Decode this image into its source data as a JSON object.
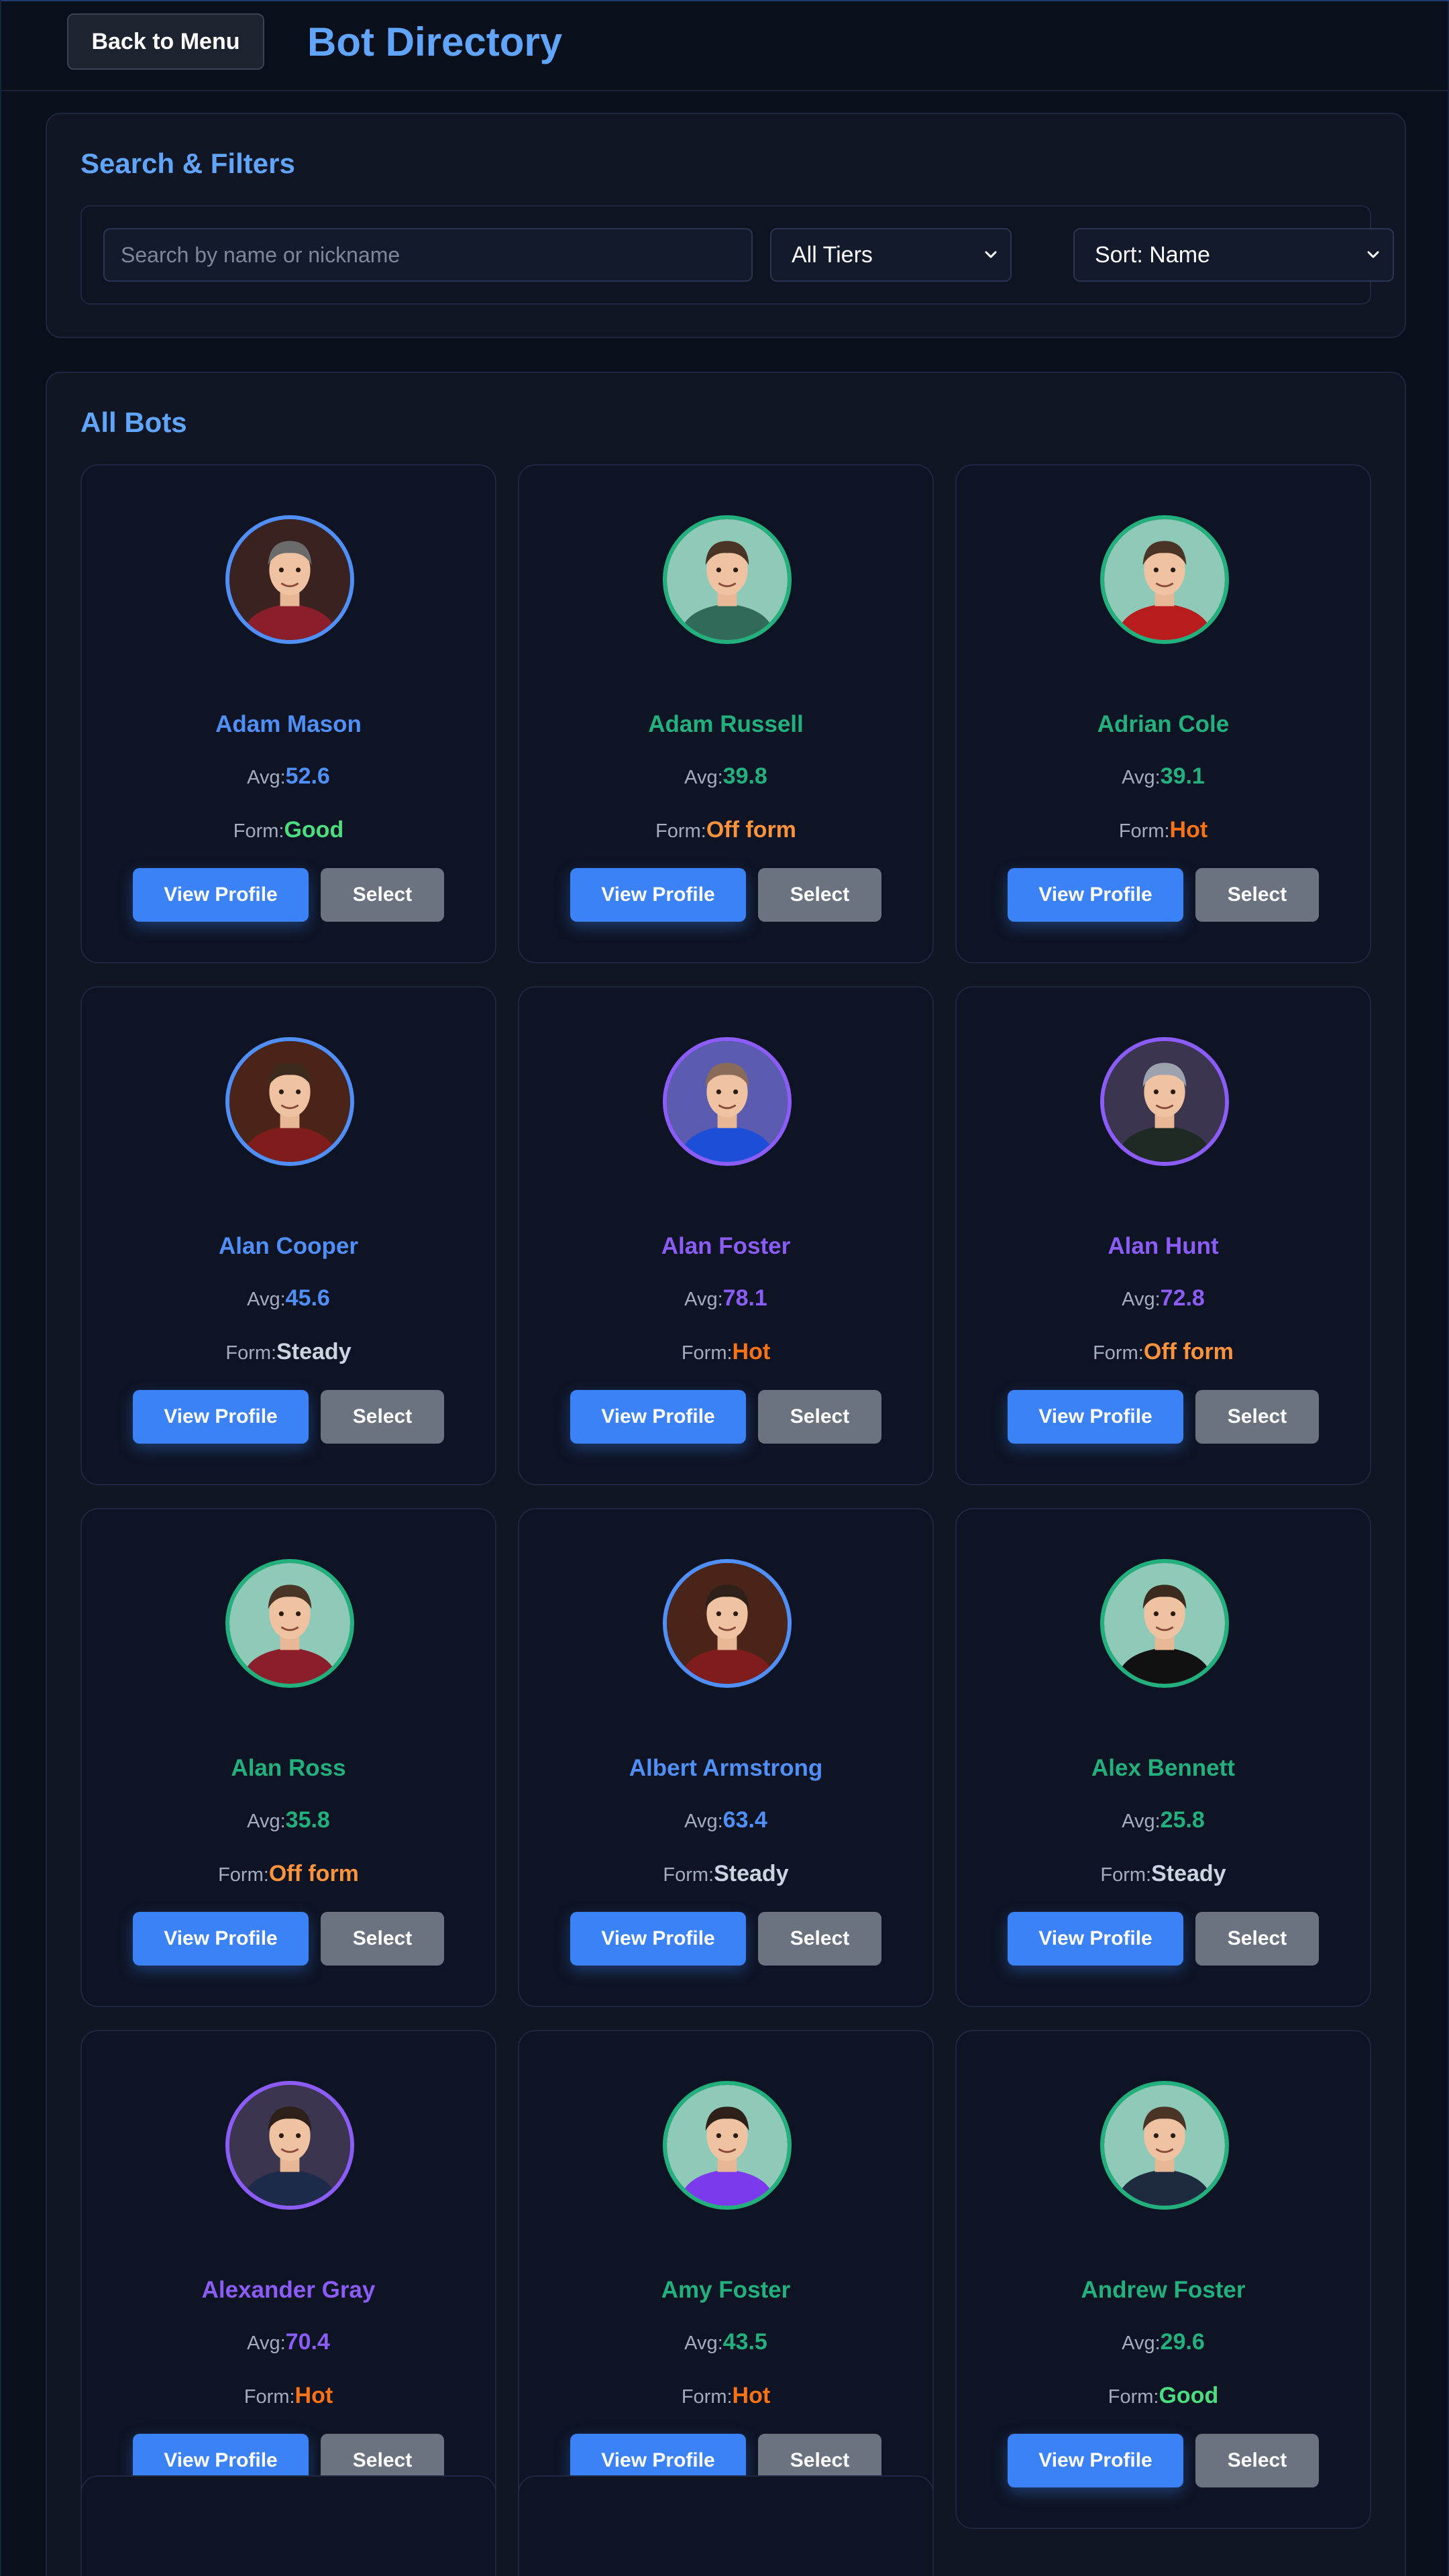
{
  "header": {
    "back_label": "Back to Menu",
    "title": "Bot Directory"
  },
  "filters": {
    "title": "Search & Filters",
    "search_placeholder": "Search by name or nickname",
    "tier_value": "All Tiers",
    "sort_value": "Sort: Name"
  },
  "bots_section": {
    "title": "All Bots",
    "avg_label": "Avg:",
    "form_label": "Form:",
    "view_label": "View Profile",
    "select_label": "Select"
  },
  "colors": {
    "tier_blue": "#4f8ff7",
    "tier_green": "#22b07d",
    "tier_purple": "#8b5cf6",
    "form_good": "#4ade80",
    "form_hot": "#f97316",
    "form_off": "#fb923c",
    "form_steady": "#cbd5e1"
  },
  "bots": [
    {
      "name": "Adam Mason",
      "avg": "52.6",
      "form": "Good",
      "tier": "blue",
      "shirt": "#8b1e2b",
      "bg": "#3a2220",
      "hair": "#6b6b6b"
    },
    {
      "name": "Adam Russell",
      "avg": "39.8",
      "form": "Off form",
      "tier": "green",
      "shirt": "#2f6b58",
      "bg": "#8fc9b8",
      "hair": "#4a3426"
    },
    {
      "name": "Adrian Cole",
      "avg": "39.1",
      "form": "Hot",
      "tier": "green",
      "shirt": "#b91c1c",
      "bg": "#8fc9b8",
      "hair": "#4a3426"
    },
    {
      "name": "Alan Cooper",
      "avg": "45.6",
      "form": "Steady",
      "tier": "blue",
      "shirt": "#7f1d1d",
      "bg": "#4a2418",
      "hair": "#3d2a1e"
    },
    {
      "name": "Alan Foster",
      "avg": "78.1",
      "form": "Hot",
      "tier": "purple",
      "shirt": "#1d4ed8",
      "bg": "#5b5bb0",
      "hair": "#8a6b5a"
    },
    {
      "name": "Alan Hunt",
      "avg": "72.8",
      "form": "Off form",
      "tier": "purple",
      "shirt": "#1f2a24",
      "bg": "#3b3550",
      "hair": "#9ca3af"
    },
    {
      "name": "Alan Ross",
      "avg": "35.8",
      "form": "Off form",
      "tier": "green",
      "shirt": "#8b1e2b",
      "bg": "#8fc9b8",
      "hair": "#4a3426"
    },
    {
      "name": "Albert Armstrong",
      "avg": "63.4",
      "form": "Steady",
      "tier": "blue",
      "shirt": "#7f1d1d",
      "bg": "#4a2418",
      "hair": "#2d2019"
    },
    {
      "name": "Alex Bennett",
      "avg": "25.8",
      "form": "Steady",
      "tier": "green",
      "shirt": "#111111",
      "bg": "#8fc9b8",
      "hair": "#3d2a1e"
    },
    {
      "name": "Alexander Gray",
      "avg": "70.4",
      "form": "Hot",
      "tier": "purple",
      "shirt": "#1e2a4a",
      "bg": "#3b3550",
      "hair": "#2d2019"
    },
    {
      "name": "Amy Foster",
      "avg": "43.5",
      "form": "Hot",
      "tier": "green",
      "shirt": "#7c3aed",
      "bg": "#8fc9b8",
      "hair": "#2d2019"
    },
    {
      "name": "Andrew Foster",
      "avg": "29.6",
      "form": "Good",
      "tier": "green",
      "shirt": "#1e2a40",
      "bg": "#8fc9b8",
      "hair": "#4a3426"
    }
  ]
}
